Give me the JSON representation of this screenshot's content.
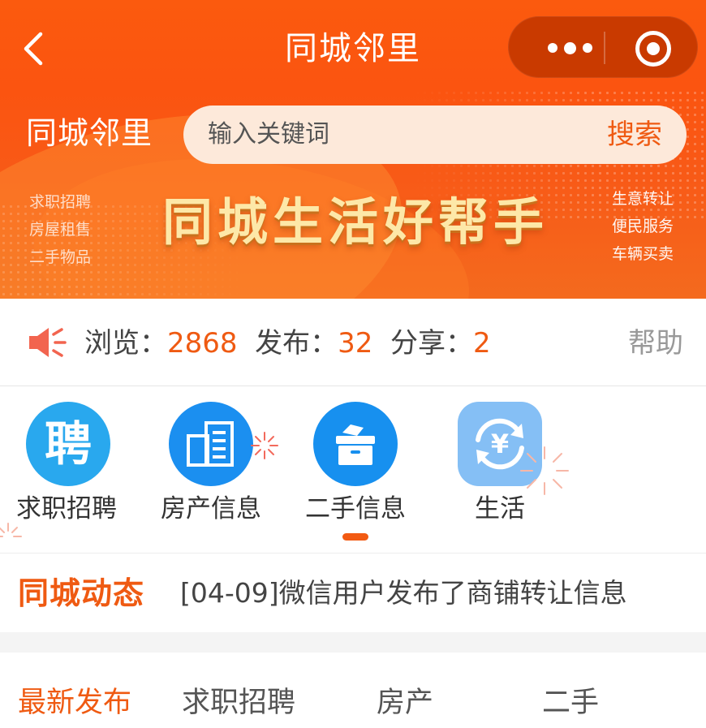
{
  "nav": {
    "title": "同城邻里",
    "back_icon": "chevron-left-icon",
    "more_icon": "more-dots-icon",
    "close_icon": "target-circle-icon"
  },
  "banner": {
    "brand": "同城邻里",
    "search_placeholder": "输入关键词",
    "search_button": "搜索",
    "slogan": "同城生活好帮手",
    "tags_left": [
      "求职招聘",
      "房屋租售",
      "二手物品"
    ],
    "tags_right": [
      "生意转让",
      "便民服务",
      "车辆买卖"
    ]
  },
  "stats": {
    "views_label": "浏览：",
    "views": "2868",
    "posts_label": "发布：",
    "posts": "32",
    "shares_label": "分享：",
    "shares": "2",
    "help": "帮助"
  },
  "categories": [
    {
      "label": "求职招聘",
      "icon": "recruit-icon",
      "glyph": "聘"
    },
    {
      "label": "房产信息",
      "icon": "building-icon"
    },
    {
      "label": "二手信息",
      "icon": "box-icon"
    },
    {
      "label": "生活",
      "icon": "yuan-exchange-icon"
    }
  ],
  "news": {
    "tag": "同城动态",
    "text": "[04-09]微信用户发布了商铺转让信息"
  },
  "tabs": [
    {
      "label": "最新发布",
      "active": true
    },
    {
      "label": "求职招聘",
      "active": false
    },
    {
      "label": "房产",
      "active": false
    },
    {
      "label": "二手",
      "active": false
    }
  ],
  "colors": {
    "brand_orange": "#fb5a0e",
    "accent_number": "#ef5a12",
    "icon_blue": "#1b8ff0",
    "icon_light_blue": "#85bff5"
  }
}
